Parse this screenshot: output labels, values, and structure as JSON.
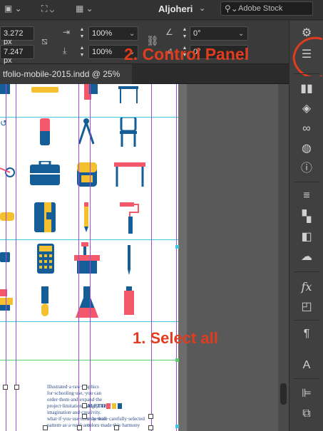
{
  "topbar": {
    "workspace": "Aljoheri",
    "search_placeholder": "Adobe Stock"
  },
  "control": {
    "x_value": "3.272 px",
    "y_value": "7.247 px",
    "scale_x": "100%",
    "scale_y": "100%",
    "rotate": "0°",
    "shear": "0°"
  },
  "document": {
    "tab_title": "tfolio-mobile-2015.indd @ 25%"
  },
  "page_text": {
    "left_col": [
      "Illustrated·a·raw·graphics",
      "for·schooling·use,·you·can",
      "order·them·and·expand·the",
      "project·limitation·using·your",
      "imagination·and·creativity.",
      "what·if·you·use·them·as·wall",
      "pattern·as·a·rural·arts"
    ],
    "right_col": [
      "ALETTE",
      "only·three·carefully·selected",
      "colors·made·this·harmony"
    ]
  },
  "annotations": {
    "control_panel": "2. Control Panel",
    "select_all": "1. Select all"
  },
  "colors": {
    "annotation_red": "#e23c1f",
    "icon_blue": "#155d96",
    "icon_pink": "#f3596b",
    "icon_yellow": "#f4c02f"
  }
}
